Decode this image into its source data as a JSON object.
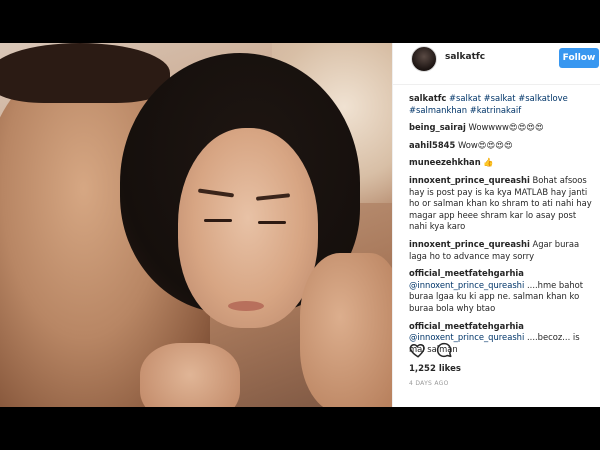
{
  "header": {
    "username": "salkatfc",
    "follow_label": "Follow"
  },
  "caption": {
    "user": "salkatfc",
    "text": "#salkat #salkat #salkatlove #salmankhan #katrinakaif"
  },
  "comments": [
    {
      "user": "being_sairaj",
      "text": "Wowwww😍😍😍😍"
    },
    {
      "user": "aahil5845",
      "text": "Wow😍😍😍😍"
    },
    {
      "user": "muneezehkhan",
      "text": "👍"
    },
    {
      "user": "innoxent_prince_qureashi",
      "text": "Bohat afsoos hay is post pay is ka kya MATLAB hay janti ho or salman khan ko shram to ati nahi hay magar app heee shram kar lo asay post nahi kya karo"
    },
    {
      "user": "innoxent_prince_qureashi",
      "text": "Agar buraa laga ho to advance may sorry"
    },
    {
      "user": "official_meetfatehgarhia",
      "mention": "@innoxent_prince_qureashi",
      "text": "....hme bahot buraa lgaa ku ki app ne. salman khan ko buraa bola why btao"
    },
    {
      "user": "official_meetfatehgarhia",
      "mention": "@innoxent_prince_qureashi",
      "text": "....becoz... is mai salman"
    }
  ],
  "actions": {
    "like_icon": "heart-outline-icon",
    "comment_icon": "speech-bubble-icon"
  },
  "likes": "1,252 likes",
  "timestamp": "4 DAYS AGO",
  "colors": {
    "follow_bg": "#3897f0",
    "tag": "#003569",
    "letterbox": "#000000"
  }
}
